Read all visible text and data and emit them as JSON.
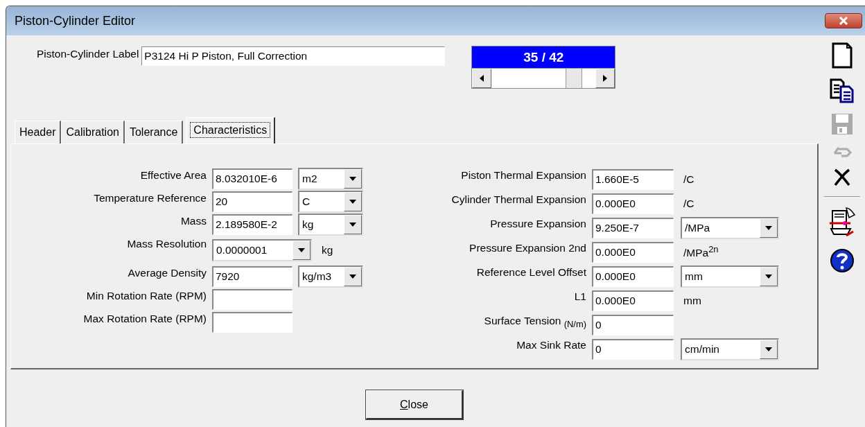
{
  "window": {
    "title": "Piston-Cylinder Editor"
  },
  "label_field": {
    "label": "Piston-Cylinder Label",
    "value": "P3124 Hi P Piston, Full Correction"
  },
  "record_slider": {
    "reading": "35 / 42",
    "level": 0.83
  },
  "tabs": [
    {
      "label": "Header",
      "selected": false
    },
    {
      "label": "Calibration",
      "selected": false
    },
    {
      "label": "Tolerance",
      "selected": false
    },
    {
      "label": "Characteristics",
      "selected": true
    }
  ],
  "left_fields": [
    {
      "label": "Effective Area",
      "value": "8.032010E-6",
      "unit": {
        "kind": "combo",
        "value": "m2"
      }
    },
    {
      "label": "Temperature Reference",
      "value": "20",
      "unit": {
        "kind": "combo",
        "value": "C"
      }
    },
    {
      "label": "Mass",
      "value": "2.189580E-2",
      "unit": {
        "kind": "combo",
        "value": "kg"
      }
    },
    {
      "label": "Mass Resolution",
      "kind": "combo",
      "value": "0.0000001",
      "unit": {
        "kind": "text",
        "value": "kg"
      }
    },
    {
      "label": "Average Density",
      "value": "7920",
      "unit": {
        "kind": "combo",
        "value": "kg/m3"
      }
    },
    {
      "label": "Min Rotation Rate  (RPM)"
    },
    {
      "label": "Max Rotation Rate (RPM)"
    }
  ],
  "right_fields": [
    {
      "label": "Piston Thermal Expansion",
      "value": "1.660E-5",
      "unit": {
        "kind": "text",
        "value": "/C"
      }
    },
    {
      "label": "Cylinder Thermal Expansion",
      "value": "0.000E0",
      "unit": {
        "kind": "text",
        "value": "/C"
      }
    },
    {
      "label": "Pressure Expansion",
      "value": "9.250E-7",
      "unit": {
        "kind": "combo",
        "value": "/MPa"
      }
    },
    {
      "label": "Pressure Expansion 2nd",
      "value": "0.000E0",
      "unit": {
        "kind": "text",
        "value": "/MPa$^{2n}$"
      }
    },
    {
      "label": "Reference Level Offset",
      "value": "0.000E0",
      "unit": {
        "kind": "combo",
        "value": "mm"
      }
    },
    {
      "label": "L1",
      "value": "0.000E0",
      "unit": {
        "kind": "text",
        "value": "mm"
      }
    },
    {
      "label": "Surface Tension $_{(N/m)}$",
      "value": "0"
    },
    {
      "label": "Max Sink Rate",
      "value": "0",
      "unit": {
        "kind": "combo",
        "value": "cm/min"
      }
    }
  ],
  "toolbar": [
    {
      "kind": "new",
      "disabled": false
    },
    {
      "kind": "copy",
      "disabled": false
    },
    {
      "kind": "save",
      "disabled": true
    },
    {
      "kind": "undo",
      "disabled": true
    },
    {
      "kind": "delete",
      "disabled": false
    },
    {
      "kind": "separator"
    },
    {
      "kind": "tool",
      "disabled": false
    },
    {
      "kind": "help",
      "disabled": false
    }
  ],
  "close_button": {
    "label": "Close"
  }
}
